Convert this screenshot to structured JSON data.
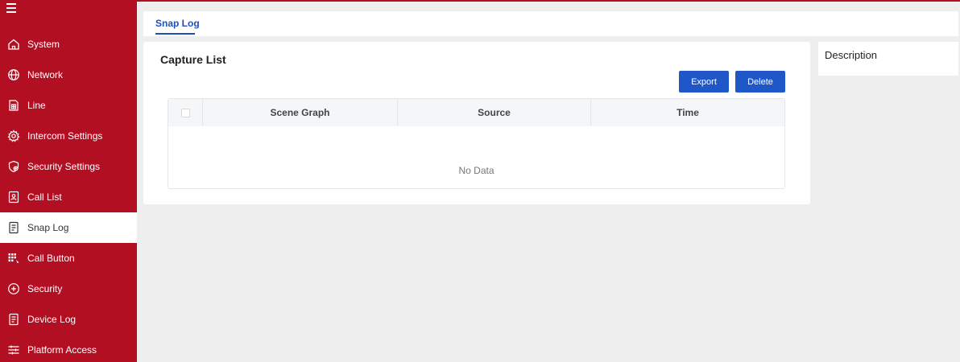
{
  "sidebar": {
    "items": [
      {
        "label": "System",
        "icon": "home-icon"
      },
      {
        "label": "Network",
        "icon": "globe-icon"
      },
      {
        "label": "Line",
        "icon": "sim-card-icon"
      },
      {
        "label": "Intercom Settings",
        "icon": "gear-icon"
      },
      {
        "label": "Security Settings",
        "icon": "shield-gear-icon"
      },
      {
        "label": "Call List",
        "icon": "contact-card-icon"
      },
      {
        "label": "Snap Log",
        "icon": "document-icon",
        "active": true
      },
      {
        "label": "Call Button",
        "icon": "keypad-icon"
      },
      {
        "label": "Security",
        "icon": "shield-plus-icon"
      },
      {
        "label": "Device Log",
        "icon": "document-icon"
      },
      {
        "label": "Platform Access",
        "icon": "sliders-icon"
      }
    ]
  },
  "tabs": {
    "active": "Snap Log"
  },
  "capture": {
    "title": "Capture List",
    "export_label": "Export",
    "delete_label": "Delete",
    "columns": [
      "Scene Graph",
      "Source",
      "Time"
    ],
    "empty_text": "No Data"
  },
  "description": {
    "title": "Description"
  },
  "colors": {
    "brand": "#b20f22",
    "accent": "#1f56c8",
    "background": "#eeeeee"
  }
}
